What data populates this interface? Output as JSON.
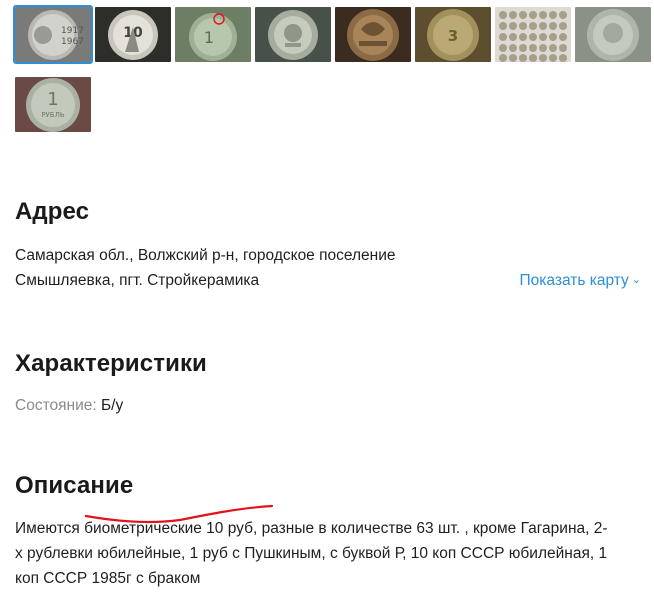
{
  "gallery": {
    "thumbnails": [
      {
        "icon": "coin-1917-1967-photo",
        "selected": true
      },
      {
        "icon": "coin-10-kopeks-photo",
        "selected": false
      },
      {
        "icon": "coin-1-ruble-marked-photo",
        "selected": false
      },
      {
        "icon": "coin-emblem-photo",
        "selected": false
      },
      {
        "icon": "coin-bronze-photo",
        "selected": false
      },
      {
        "icon": "coin-3-kopeks-photo",
        "selected": false
      },
      {
        "icon": "coin-collection-grid-photo",
        "selected": false
      },
      {
        "icon": "coin-faded-emblem-photo",
        "selected": false
      },
      {
        "icon": "coin-1-ruble-photo",
        "selected": false
      }
    ]
  },
  "address": {
    "heading": "Адрес",
    "line1": "Самарская обл., Волжский р-н, городское поселение",
    "line2": "Смышляевка, пгт. Стройкерамика",
    "map_link": "Показать карту"
  },
  "characteristics": {
    "heading": "Характеристики",
    "condition_label": "Состояние:",
    "condition_value": "Б/у"
  },
  "description": {
    "heading": "Описание",
    "line1": "Имеются биометрические 10 руб, разные в количестве 63 шт. , кроме Гагарина, 2-",
    "line2": "х рублевки юбилейные, 1 руб с Пушкиным, с буквой Р, 10 коп СССР юбилейная, 1",
    "line3": "коп СССР 1985г с браком"
  },
  "colors": {
    "link": "#2b8fd9",
    "selected_border": "#2b90d9",
    "annotation": "#e0141b"
  }
}
